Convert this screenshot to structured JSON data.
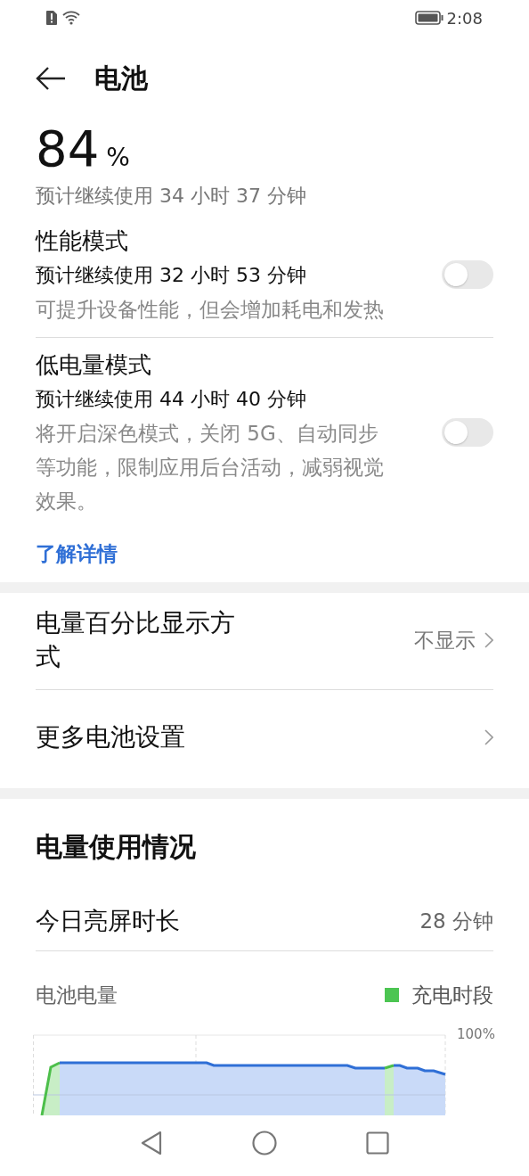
{
  "status_bar": {
    "time": "2:08"
  },
  "header": {
    "title": "电池"
  },
  "battery": {
    "percent": "84",
    "unit": "%",
    "estimate": "预计继续使用 34 小时 37 分钟"
  },
  "modes": [
    {
      "title": "性能模式",
      "estimate": "预计继续使用 32 小时 53 分钟",
      "description": "可提升设备性能，但会增加耗电和发热",
      "on": false
    },
    {
      "title": "低电量模式",
      "estimate": "预计继续使用 44 小时 40 分钟",
      "description": "将开启深色模式，关闭 5G、自动同步等功能，限制应用后台活动，减弱视觉效果。",
      "on": false
    }
  ],
  "learn_more": "了解详情",
  "settings": [
    {
      "label": "电量百分比显示方式",
      "value": "不显示"
    },
    {
      "label": "更多电池设置"
    }
  ],
  "usage": {
    "title": "电量使用情况",
    "screen_time_label": "今日亮屏时长",
    "screen_time_value": "28 分钟",
    "chart_title": "电池电量",
    "legend": {
      "label": "充电时段",
      "color": "#4cc552"
    },
    "top_tick": "100%"
  }
}
